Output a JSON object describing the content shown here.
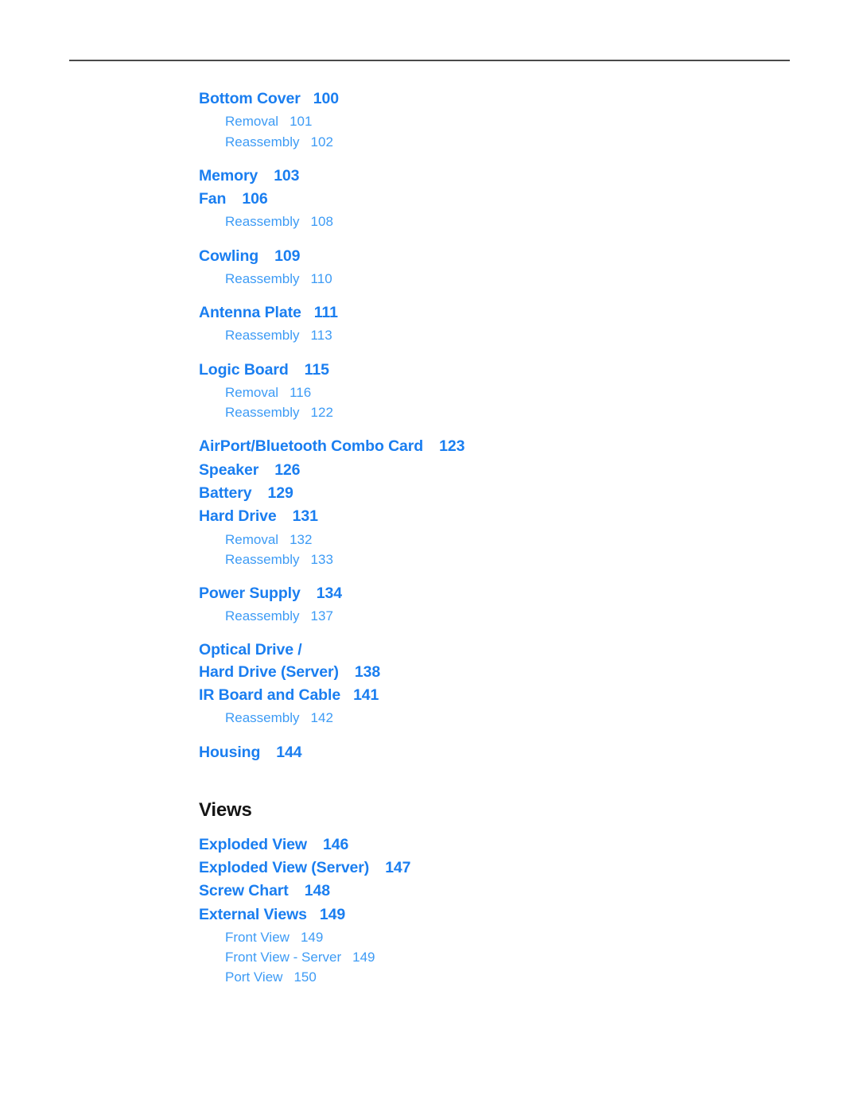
{
  "colors": {
    "entry_blue": "#1a7ef0",
    "sub_blue": "#3d9bf5",
    "heading_black": "#151515",
    "rule_gray": "#4a4a4a",
    "page_background": "#ffffff"
  },
  "toc": {
    "groups": [
      {
        "entry": {
          "title": "Bottom Cover",
          "page": "100"
        },
        "subs": [
          {
            "title": "Removal",
            "page": "101"
          },
          {
            "title": "Reassembly",
            "page": "102"
          }
        ]
      },
      {
        "entry": {
          "title": "Memory",
          "page": "103"
        },
        "subs": []
      },
      {
        "entry": {
          "title": "Fan",
          "page": "106"
        },
        "subs": [
          {
            "title": "Reassembly",
            "page": "108"
          }
        ]
      },
      {
        "entry": {
          "title": "Cowling",
          "page": "109"
        },
        "subs": [
          {
            "title": "Reassembly",
            "page": "110"
          }
        ]
      },
      {
        "entry": {
          "title": "Antenna Plate",
          "page": "111"
        },
        "subs": [
          {
            "title": "Reassembly",
            "page": "113"
          }
        ]
      },
      {
        "entry": {
          "title": "Logic Board",
          "page": "115"
        },
        "subs": [
          {
            "title": "Removal",
            "page": "116"
          },
          {
            "title": "Reassembly",
            "page": "122"
          }
        ]
      },
      {
        "entry": {
          "title": "AirPort/Bluetooth Combo Card",
          "page": "123"
        },
        "subs": []
      },
      {
        "entry": {
          "title": "Speaker",
          "page": "126"
        },
        "subs": []
      },
      {
        "entry": {
          "title": "Battery",
          "page": "129"
        },
        "subs": []
      },
      {
        "entry": {
          "title": "Hard Drive",
          "page": "131"
        },
        "subs": [
          {
            "title": "Removal",
            "page": "132"
          },
          {
            "title": "Reassembly",
            "page": "133"
          }
        ]
      },
      {
        "entry": {
          "title": "Power Supply",
          "page": "134"
        },
        "subs": [
          {
            "title": "Reassembly",
            "page": "137"
          }
        ]
      },
      {
        "entry": {
          "title_line1": "Optical Drive /",
          "title_line2": "Hard Drive (Server)",
          "page": "138"
        },
        "subs": []
      },
      {
        "entry": {
          "title": "IR Board and Cable",
          "page": "141"
        },
        "subs": [
          {
            "title": "Reassembly",
            "page": "142"
          }
        ]
      },
      {
        "entry": {
          "title": "Housing",
          "page": "144"
        },
        "subs": []
      }
    ]
  },
  "views_section": {
    "heading": "Views",
    "groups": [
      {
        "entry": {
          "title": "Exploded View",
          "page": "146"
        },
        "subs": []
      },
      {
        "entry": {
          "title": "Exploded View (Server)",
          "page": "147"
        },
        "subs": []
      },
      {
        "entry": {
          "title": "Screw Chart",
          "page": "148"
        },
        "subs": []
      },
      {
        "entry": {
          "title": "External Views",
          "page": "149"
        },
        "subs": [
          {
            "title": "Front View",
            "page": "149"
          },
          {
            "title": "Front View - Server",
            "page": "149"
          },
          {
            "title": "Port View",
            "page": "150"
          }
        ]
      }
    ]
  }
}
